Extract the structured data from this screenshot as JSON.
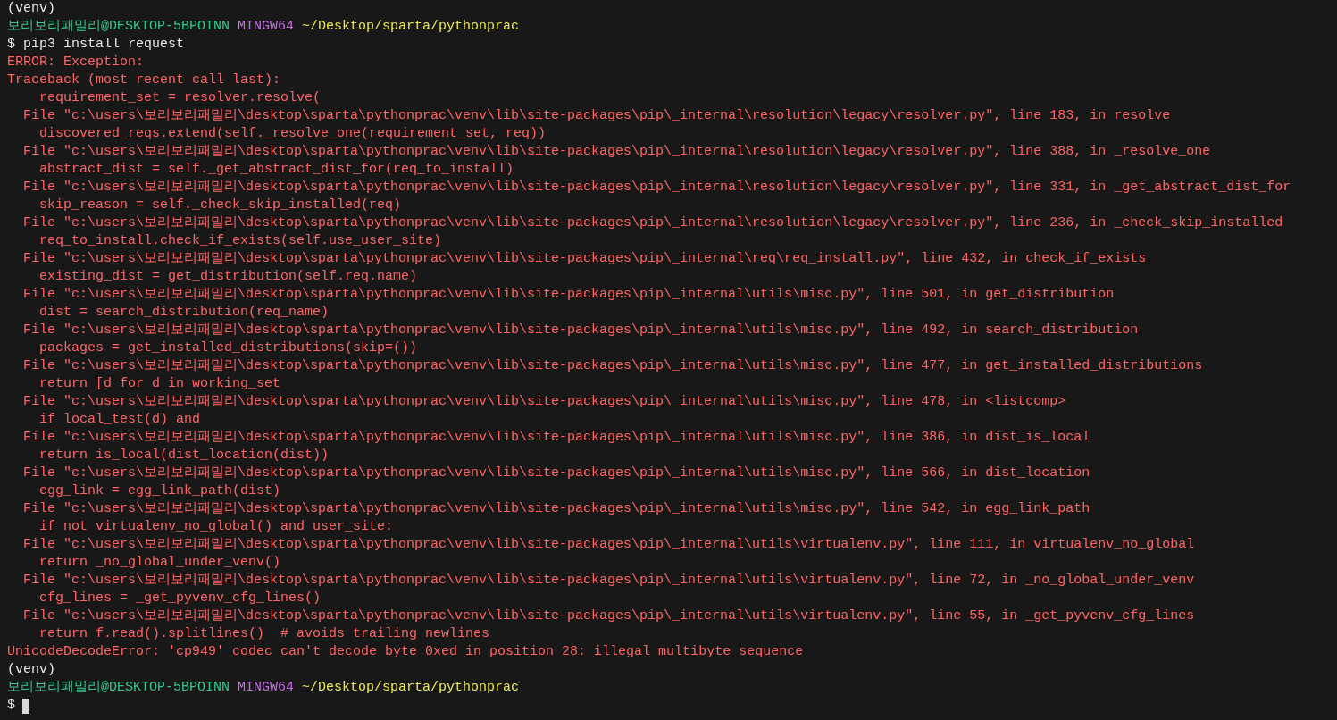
{
  "terminal": {
    "lines": [
      {
        "kind": "plain",
        "text": "(venv)"
      },
      {
        "kind": "prompt",
        "user_host": "보리보리패밀리@DESKTOP-5BPOINN",
        "shell": "MINGW64",
        "path": "~/Desktop/sparta/pythonprac"
      },
      {
        "kind": "input",
        "text": "$ pip3 install request",
        "cursor": false
      },
      {
        "kind": "error",
        "text": "ERROR: Exception:"
      },
      {
        "kind": "error",
        "text": "Traceback (most recent call last):"
      },
      {
        "kind": "error",
        "text": "    requirement_set = resolver.resolve("
      },
      {
        "kind": "error",
        "text": "  File \"c:\\users\\보리보리패밀리\\desktop\\sparta\\pythonprac\\venv\\lib\\site-packages\\pip\\_internal\\resolution\\legacy\\resolver.py\", line 183, in resolve"
      },
      {
        "kind": "error",
        "text": "    discovered_reqs.extend(self._resolve_one(requirement_set, req))"
      },
      {
        "kind": "error",
        "text": "  File \"c:\\users\\보리보리패밀리\\desktop\\sparta\\pythonprac\\venv\\lib\\site-packages\\pip\\_internal\\resolution\\legacy\\resolver.py\", line 388, in _resolve_one"
      },
      {
        "kind": "error",
        "text": "    abstract_dist = self._get_abstract_dist_for(req_to_install)"
      },
      {
        "kind": "error",
        "text": "  File \"c:\\users\\보리보리패밀리\\desktop\\sparta\\pythonprac\\venv\\lib\\site-packages\\pip\\_internal\\resolution\\legacy\\resolver.py\", line 331, in _get_abstract_dist_for"
      },
      {
        "kind": "error",
        "text": "    skip_reason = self._check_skip_installed(req)"
      },
      {
        "kind": "error",
        "text": "  File \"c:\\users\\보리보리패밀리\\desktop\\sparta\\pythonprac\\venv\\lib\\site-packages\\pip\\_internal\\resolution\\legacy\\resolver.py\", line 236, in _check_skip_installed"
      },
      {
        "kind": "error",
        "text": "    req_to_install.check_if_exists(self.use_user_site)"
      },
      {
        "kind": "error",
        "text": "  File \"c:\\users\\보리보리패밀리\\desktop\\sparta\\pythonprac\\venv\\lib\\site-packages\\pip\\_internal\\req\\req_install.py\", line 432, in check_if_exists"
      },
      {
        "kind": "error",
        "text": "    existing_dist = get_distribution(self.req.name)"
      },
      {
        "kind": "error",
        "text": "  File \"c:\\users\\보리보리패밀리\\desktop\\sparta\\pythonprac\\venv\\lib\\site-packages\\pip\\_internal\\utils\\misc.py\", line 501, in get_distribution"
      },
      {
        "kind": "error",
        "text": "    dist = search_distribution(req_name)"
      },
      {
        "kind": "error",
        "text": "  File \"c:\\users\\보리보리패밀리\\desktop\\sparta\\pythonprac\\venv\\lib\\site-packages\\pip\\_internal\\utils\\misc.py\", line 492, in search_distribution"
      },
      {
        "kind": "error",
        "text": "    packages = get_installed_distributions(skip=())"
      },
      {
        "kind": "error",
        "text": "  File \"c:\\users\\보리보리패밀리\\desktop\\sparta\\pythonprac\\venv\\lib\\site-packages\\pip\\_internal\\utils\\misc.py\", line 477, in get_installed_distributions"
      },
      {
        "kind": "error",
        "text": "    return [d for d in working_set"
      },
      {
        "kind": "error",
        "text": "  File \"c:\\users\\보리보리패밀리\\desktop\\sparta\\pythonprac\\venv\\lib\\site-packages\\pip\\_internal\\utils\\misc.py\", line 478, in <listcomp>"
      },
      {
        "kind": "error",
        "text": "    if local_test(d) and"
      },
      {
        "kind": "error",
        "text": "  File \"c:\\users\\보리보리패밀리\\desktop\\sparta\\pythonprac\\venv\\lib\\site-packages\\pip\\_internal\\utils\\misc.py\", line 386, in dist_is_local"
      },
      {
        "kind": "error",
        "text": "    return is_local(dist_location(dist))"
      },
      {
        "kind": "error",
        "text": "  File \"c:\\users\\보리보리패밀리\\desktop\\sparta\\pythonprac\\venv\\lib\\site-packages\\pip\\_internal\\utils\\misc.py\", line 566, in dist_location"
      },
      {
        "kind": "error",
        "text": "    egg_link = egg_link_path(dist)"
      },
      {
        "kind": "error",
        "text": "  File \"c:\\users\\보리보리패밀리\\desktop\\sparta\\pythonprac\\venv\\lib\\site-packages\\pip\\_internal\\utils\\misc.py\", line 542, in egg_link_path"
      },
      {
        "kind": "error",
        "text": "    if not virtualenv_no_global() and user_site:"
      },
      {
        "kind": "error",
        "text": "  File \"c:\\users\\보리보리패밀리\\desktop\\sparta\\pythonprac\\venv\\lib\\site-packages\\pip\\_internal\\utils\\virtualenv.py\", line 111, in virtualenv_no_global"
      },
      {
        "kind": "error",
        "text": "    return _no_global_under_venv()"
      },
      {
        "kind": "error",
        "text": "  File \"c:\\users\\보리보리패밀리\\desktop\\sparta\\pythonprac\\venv\\lib\\site-packages\\pip\\_internal\\utils\\virtualenv.py\", line 72, in _no_global_under_venv"
      },
      {
        "kind": "error",
        "text": "    cfg_lines = _get_pyvenv_cfg_lines()"
      },
      {
        "kind": "error",
        "text": "  File \"c:\\users\\보리보리패밀리\\desktop\\sparta\\pythonprac\\venv\\lib\\site-packages\\pip\\_internal\\utils\\virtualenv.py\", line 55, in _get_pyvenv_cfg_lines"
      },
      {
        "kind": "error",
        "text": "    return f.read().splitlines()  # avoids trailing newlines"
      },
      {
        "kind": "error",
        "text": "UnicodeDecodeError: 'cp949' codec can't decode byte 0xed in position 28: illegal multibyte sequence"
      },
      {
        "kind": "plain",
        "text": "(venv)"
      },
      {
        "kind": "prompt",
        "user_host": "보리보리패밀리@DESKTOP-5BPOINN",
        "shell": "MINGW64",
        "path": "~/Desktop/sparta/pythonprac"
      },
      {
        "kind": "input",
        "text": "$",
        "cursor": true
      }
    ]
  }
}
